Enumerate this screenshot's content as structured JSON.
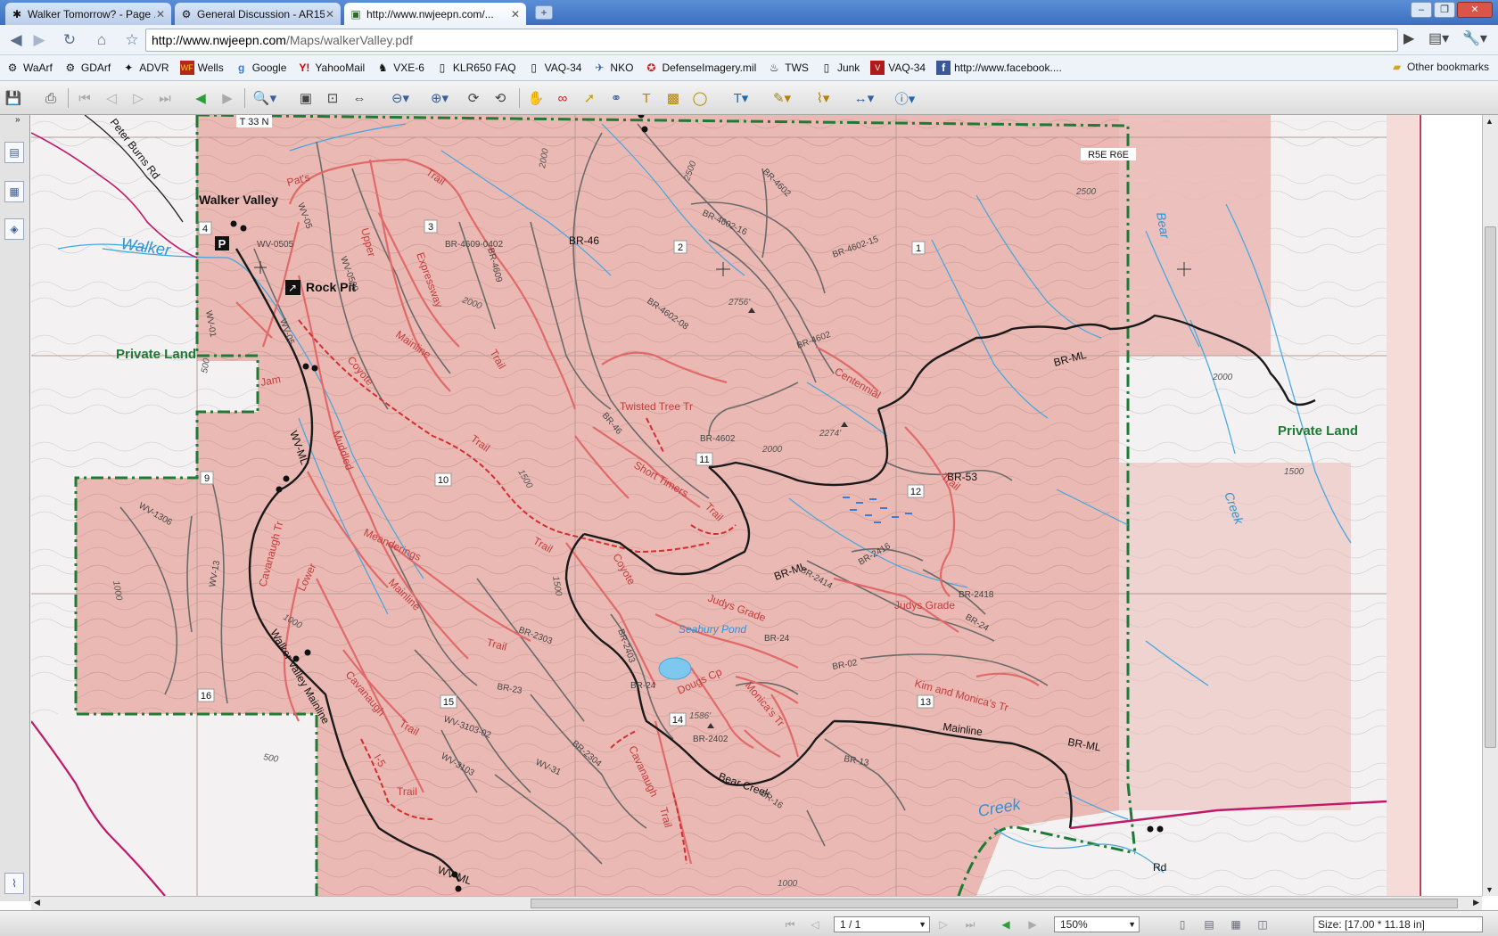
{
  "browser": {
    "tabs": [
      {
        "title": "Walker Tomorrow? - Page ...",
        "icon": "forum-icon"
      },
      {
        "title": "General Discussion - AR15....",
        "icon": "gear-icon"
      },
      {
        "title": "http://www.nwjeepn.com/...",
        "icon": "jeep-icon"
      }
    ],
    "new_tab": "+",
    "url_host": "http://www.nwjeepn.com",
    "url_path": "/Maps/walkerValley.pdf",
    "bookmarks": [
      {
        "label": "WaArf",
        "icon": "gear-icon"
      },
      {
        "label": "GDArf",
        "icon": "gear-icon"
      },
      {
        "label": "ADVR",
        "icon": "moto-icon"
      },
      {
        "label": "Wells",
        "icon": "wf-icon"
      },
      {
        "label": "Google",
        "icon": "google-icon"
      },
      {
        "label": "YahooMail",
        "icon": "yahoo-icon"
      },
      {
        "label": "VXE-6",
        "icon": "squadron-icon"
      },
      {
        "label": "KLR650 FAQ",
        "icon": "page-icon"
      },
      {
        "label": "VAQ-34",
        "icon": "page-icon"
      },
      {
        "label": "NKO",
        "icon": "navy-icon"
      },
      {
        "label": "DefenseImagery.mil",
        "icon": "star-icon"
      },
      {
        "label": "TWS",
        "icon": "tws-icon"
      },
      {
        "label": "Junk",
        "icon": "page-icon"
      },
      {
        "label": "VAQ-34",
        "icon": "vaq-icon"
      },
      {
        "label": "http://www.facebook....",
        "icon": "facebook-icon"
      }
    ],
    "other_bookmarks": "Other bookmarks"
  },
  "pdf": {
    "page_indicator": "1 / 1",
    "zoom": "150%",
    "size": "Size: [17.00 * 11.18 in]"
  },
  "map": {
    "colors": {
      "land": "#eab9b4",
      "private": "#f4f4f4",
      "road": "#1a1a1a",
      "trail": "#e05a5a",
      "water": "#3fa6e0",
      "boundary": "#1f7a36",
      "gray_road": "#6a6a6a"
    },
    "labels": {
      "township": "T 33 N",
      "range": "R5E R6E",
      "walker_valley": "Walker Valley",
      "walker": "Walker",
      "private_land": "Private Land",
      "rock_pit": "Rock Pit",
      "pats": "Pat's",
      "trail": "Trail",
      "upper": "Upper",
      "expressway": "Expressway",
      "mainline": "Mainline",
      "coyote": "Coyote",
      "jam": "Jam",
      "muddled": "Muddled",
      "twisted_tree": "Twisted Tree Tr",
      "short_timers": "Short Timers",
      "centennial": "Centennial",
      "cavanaugh": "Cavanaugh",
      "cavanaugh_tr": "Cavanaugh Tr",
      "lower": "Lower",
      "meanderings": "Meanderings",
      "judys_grade": "Judys Grade",
      "seabury_pond": "Seabury Pond",
      "dougs_cp": "Dougs Cp",
      "kim_monicas": "Kim and Monica's Tr",
      "monicas_tr": "Monica's Tr",
      "walker_valley_ml": "Walker Valley Mainline",
      "bear_creek": "Bear Creek",
      "creek": "Creek",
      "bear": "Bear",
      "rd": "Rd",
      "peter_burns": "Peter Burns Rd",
      "br_ml": "BR-ML",
      "wv_ml": "WV-ML",
      "br_46": "BR-46",
      "br_53": "BR-53",
      "br_4602": "BR-4602",
      "br_4602_16": "BR-4602-16",
      "br_4602_15": "BR-4602-15",
      "br_4602_08": "BR-4602-08",
      "br_4609": "BR-4609",
      "br_4609_0402": "BR-4609-0402",
      "br_2416": "BR-2416",
      "br_2414": "BR-2414",
      "br_2418": "BR-2418",
      "br_24": "BR-24",
      "br_02": "BR-02",
      "br_2303": "BR-2303",
      "br_23": "BR-23",
      "br_2403": "BR-2403",
      "br_2304": "BR-2304",
      "br_2402": "BR-2402",
      "br_13": "BR-13",
      "br_16": "BR-16",
      "wv_05": "WV-05",
      "wv_0505": "WV-0505",
      "wv_0509": "WV-0509",
      "wv_01": "WV-01",
      "wv_1306": "WV-1306",
      "wv_13": "WV-13",
      "wv_3103": "WV-3103",
      "wv_3103_02": "WV-3103-02",
      "wv_31": "WV-31",
      "i5": "I-5",
      "elev_2756": "2756'",
      "elev_2274": "2274'",
      "elev_1586": "1586'",
      "c2000": "2000",
      "c2500": "2500",
      "c1500": "1500",
      "c1000": "1000",
      "c500": "500",
      "sections": [
        "1",
        "2",
        "3",
        "4",
        "9",
        "10",
        "11",
        "12",
        "13",
        "14",
        "15",
        "16"
      ]
    }
  }
}
